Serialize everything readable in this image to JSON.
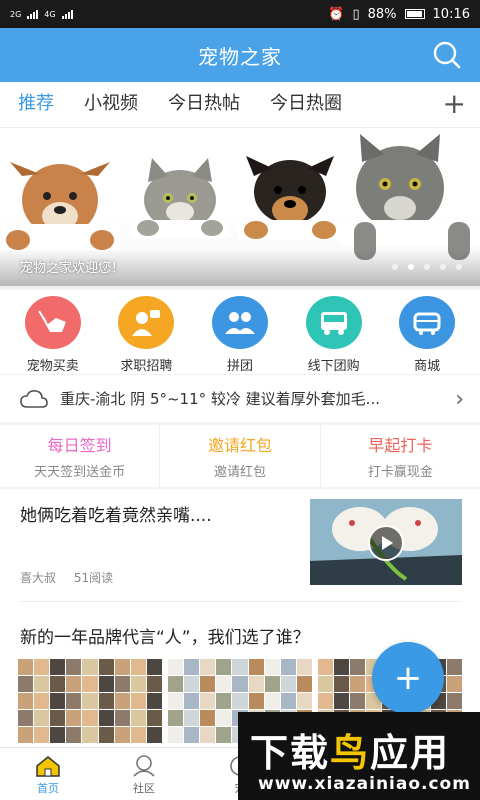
{
  "status_bar": {
    "network_left": "2G",
    "network_right": "4G",
    "battery": "88%",
    "time": "10:16"
  },
  "header": {
    "title": "宠物之家"
  },
  "tabs": [
    {
      "label": "推荐",
      "active": true
    },
    {
      "label": "小视频"
    },
    {
      "label": "今日热帖"
    },
    {
      "label": "今日热圈"
    }
  ],
  "banner": {
    "caption": "宠物之家欢迎您！",
    "slide_count": 5,
    "active_slide": 2
  },
  "services": [
    {
      "label": "宠物买卖",
      "color": "#f26b6b",
      "icon": "dog-leash-icon"
    },
    {
      "label": "求职招聘",
      "color": "#f5a623",
      "icon": "job-icon"
    },
    {
      "label": "拼团",
      "color": "#3b95e0",
      "icon": "group-icon"
    },
    {
      "label": "线下团购",
      "color": "#2ec4b6",
      "icon": "bus-icon"
    },
    {
      "label": "商城",
      "color": "#3b95e0",
      "icon": "shop-icon"
    }
  ],
  "weather": {
    "text": "重庆-渝北 阴 5°~11° 较冷 建议着厚外套加毛..."
  },
  "promos": [
    {
      "title": "每日签到",
      "subtitle": "天天签到送金币",
      "color": "#ea68c7"
    },
    {
      "title": "邀请红包",
      "subtitle": "邀请红包",
      "color": "#f5a623"
    },
    {
      "title": "早起打卡",
      "subtitle": "打卡赢现金",
      "color": "#f0615a"
    }
  ],
  "feed": [
    {
      "title": "她俩吃着吃着竟然亲嘴....",
      "author": "喜大叔",
      "reads": "51阅读"
    },
    {
      "title": "新的一年品牌代言“人”，我们选了谁？"
    }
  ],
  "fab": {
    "label": "+"
  },
  "bottom_nav": [
    {
      "label": "首页",
      "active": true
    },
    {
      "label": "社区"
    },
    {
      "label": "宠"
    }
  ],
  "watermark": {
    "part1": "下载",
    "part2": "鸟",
    "part3": "应用",
    "url": "www.xiazainiao.com"
  }
}
